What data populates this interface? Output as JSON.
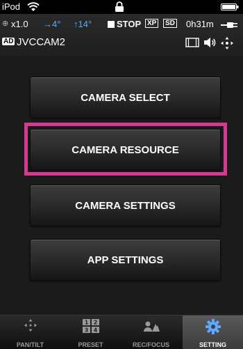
{
  "status_bar": {
    "device": "iPod"
  },
  "camera_info": {
    "zoom": "x1.0",
    "pan": "→4°",
    "tilt": "↑14°",
    "rec_status": "STOP",
    "format_badge": "XP",
    "media_badge": "SD",
    "remaining_time": "0h31m",
    "ad_badge": "AD",
    "camera_name": "JVCCAM2"
  },
  "menu": {
    "camera_select": "CAMERA SELECT",
    "camera_resource": "CAMERA RESOURCE",
    "camera_settings": "CAMERA SETTINGS",
    "app_settings": "APP SETTINGS"
  },
  "tabs": [
    {
      "label": "PAN/TILT",
      "icon": "pan-tilt-icon",
      "active": false
    },
    {
      "label": "PRESET",
      "icon": "preset-icon",
      "active": false
    },
    {
      "label": "REC/FOCUS",
      "icon": "rec-focus-icon",
      "active": false
    },
    {
      "label": "SETTING",
      "icon": "gear-icon",
      "active": true
    }
  ],
  "colors": {
    "highlight": "#d63a90",
    "accent_blue": "#4fb0ff",
    "active_icon": "#5fa8ff"
  }
}
